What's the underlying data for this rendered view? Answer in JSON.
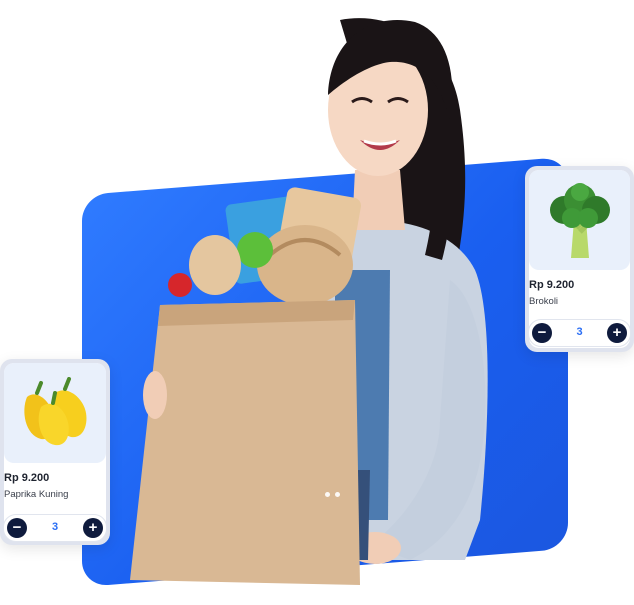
{
  "products": [
    {
      "price": "Rp 9.200",
      "name": "Brokoli",
      "quantity": "3",
      "icon": "broccoli-icon",
      "minus_label": "−",
      "plus_label": "+"
    },
    {
      "price": "Rp 9.200",
      "name": "Paprika Kuning",
      "quantity": "3",
      "icon": "yellow-pepper-icon",
      "minus_label": "−",
      "plus_label": "+"
    }
  ],
  "colors": {
    "accent_blue": "#1f66f0",
    "stepper_button": "#0f1b3d",
    "quantity_text": "#2a6ef5"
  }
}
